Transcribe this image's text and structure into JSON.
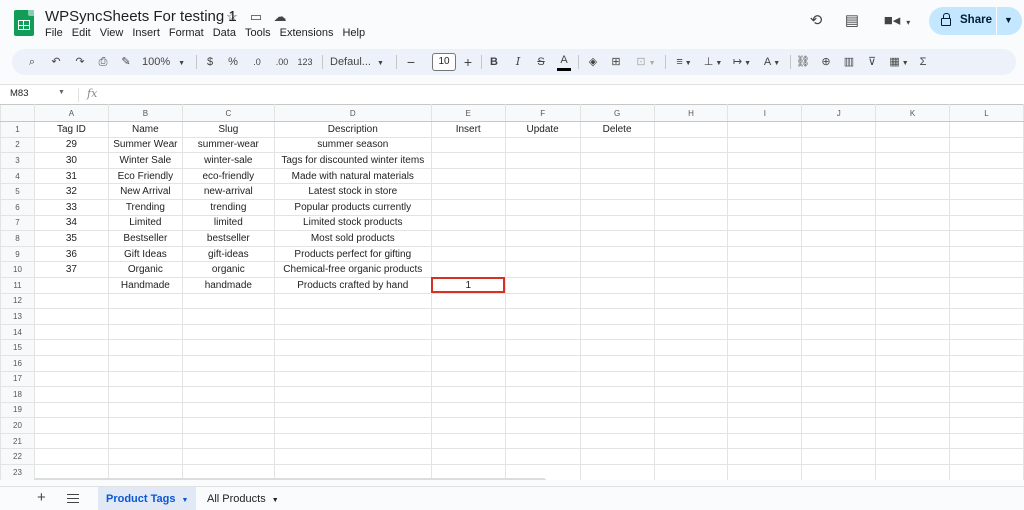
{
  "app": {
    "title": "WPSyncSheets For testing 1",
    "menu": [
      "File",
      "Edit",
      "View",
      "Insert",
      "Format",
      "Data",
      "Tools",
      "Extensions",
      "Help"
    ],
    "share_label": "Share"
  },
  "toolbar": {
    "zoom": "100%",
    "currency": "$",
    "percent": "%",
    "decrease_decimal": ".0",
    "increase_decimal": ".00",
    "number_format": "123",
    "font_family": "Defaul...",
    "font_size": "10",
    "bold": "B",
    "italic": "I",
    "strikethrough": "S",
    "text_color": "A",
    "sum": "Σ"
  },
  "formula_bar": {
    "name_box": "M83",
    "fx": "fx"
  },
  "grid": {
    "columns": [
      "A",
      "B",
      "C",
      "D",
      "E",
      "F",
      "G",
      "H",
      "I",
      "J",
      "K",
      "L"
    ],
    "row_numbers": [
      "1",
      "2",
      "3",
      "4",
      "5",
      "6",
      "7",
      "8",
      "9",
      "10",
      "11",
      "12",
      "13",
      "14",
      "15",
      "16",
      "17",
      "18",
      "19",
      "20",
      "21",
      "22",
      "23"
    ],
    "rows": [
      [
        "Tag ID",
        "Name",
        "Slug",
        "Description",
        "Insert",
        "Update",
        "Delete",
        "",
        "",
        "",
        "",
        ""
      ],
      [
        "29",
        "Summer Wear",
        "summer-wear",
        "summer season",
        "",
        "",
        "",
        "",
        "",
        "",
        "",
        ""
      ],
      [
        "30",
        "Winter Sale",
        "winter-sale",
        "Tags for discounted winter items",
        "",
        "",
        "",
        "",
        "",
        "",
        "",
        ""
      ],
      [
        "31",
        "Eco Friendly",
        "eco-friendly",
        "Made with natural materials",
        "",
        "",
        "",
        "",
        "",
        "",
        "",
        ""
      ],
      [
        "32",
        "New Arrival",
        "new-arrival",
        "Latest stock in store",
        "",
        "",
        "",
        "",
        "",
        "",
        "",
        ""
      ],
      [
        "33",
        "Trending",
        "trending",
        "Popular products currently",
        "",
        "",
        "",
        "",
        "",
        "",
        "",
        ""
      ],
      [
        "34",
        "Limited",
        "limited",
        "Limited stock products",
        "",
        "",
        "",
        "",
        "",
        "",
        "",
        ""
      ],
      [
        "35",
        "Bestseller",
        "bestseller",
        "Most sold products",
        "",
        "",
        "",
        "",
        "",
        "",
        "",
        ""
      ],
      [
        "36",
        "Gift Ideas",
        "gift-ideas",
        "Products perfect for gifting",
        "",
        "",
        "",
        "",
        "",
        "",
        "",
        ""
      ],
      [
        "37",
        "Organic",
        "organic",
        "Chemical-free organic products",
        "",
        "",
        "",
        "",
        "",
        "",
        "",
        ""
      ],
      [
        "",
        "Handmade",
        "handmade",
        "Products crafted by hand",
        "1",
        "",
        "",
        "",
        "",
        "",
        "",
        ""
      ]
    ],
    "selected_cell": "E11"
  },
  "sheet_tabs": [
    {
      "label": "Product Tags",
      "active": true
    },
    {
      "label": "All Products",
      "active": false
    }
  ],
  "colors": {
    "accent": "#0b57d0",
    "share_bg": "#c2e7ff",
    "selection": "#d93025",
    "sheets_green": "#0f9d58"
  }
}
